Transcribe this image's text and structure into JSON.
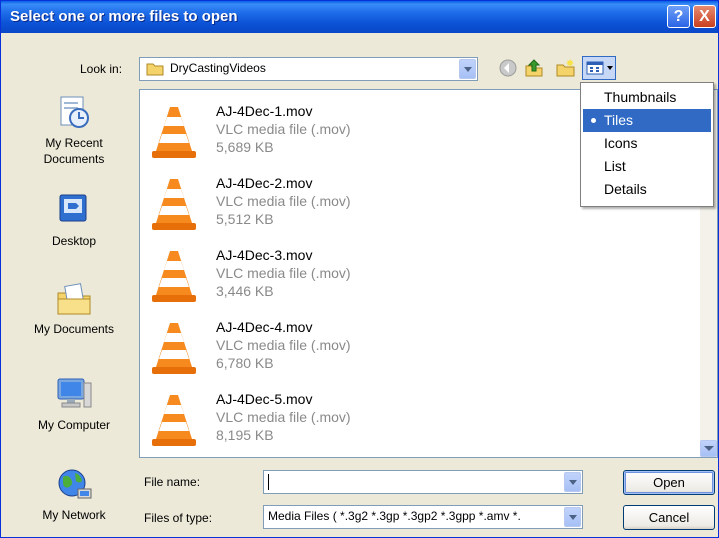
{
  "dialog": {
    "title": "Select one or more files to open",
    "help_glyph": "?",
    "close_glyph": "X"
  },
  "look_in": {
    "label": "Look in:",
    "value": "DryCastingVideos"
  },
  "places": [
    {
      "label": "My Recent Documents",
      "icon": "recent-documents-icon"
    },
    {
      "label": "Desktop",
      "icon": "desktop-icon"
    },
    {
      "label": "My Documents",
      "icon": "my-documents-icon"
    },
    {
      "label": "My Computer",
      "icon": "my-computer-icon"
    },
    {
      "label": "My Network",
      "icon": "my-network-icon"
    }
  ],
  "files": [
    {
      "name": "AJ-4Dec-1.mov",
      "type": "VLC media file (.mov)",
      "size": "5,689 KB"
    },
    {
      "name": "AJ-4Dec-2.mov",
      "type": "VLC media file (.mov)",
      "size": "5,512 KB"
    },
    {
      "name": "AJ-4Dec-3.mov",
      "type": "VLC media file (.mov)",
      "size": "3,446 KB"
    },
    {
      "name": "AJ-4Dec-4.mov",
      "type": "VLC media file (.mov)",
      "size": "6,780 KB"
    },
    {
      "name": "AJ-4Dec-5.mov",
      "type": "VLC media file (.mov)",
      "size": "8,195 KB"
    }
  ],
  "view_menu": {
    "items": [
      "Thumbnails",
      "Tiles",
      "Icons",
      "List",
      "Details"
    ],
    "selected": "Tiles"
  },
  "file_name": {
    "label": "File name:",
    "value": ""
  },
  "files_of_type": {
    "label": "Files of type:",
    "value": "Media Files ( *.3g2 *.3gp *.3gp2 *.3gpp *.amv *."
  },
  "buttons": {
    "open": "Open",
    "cancel": "Cancel"
  },
  "colors": {
    "titlebar": "#0A5FE5",
    "menu_selection": "#316AC5",
    "dialog_face": "#ECE9D8"
  }
}
